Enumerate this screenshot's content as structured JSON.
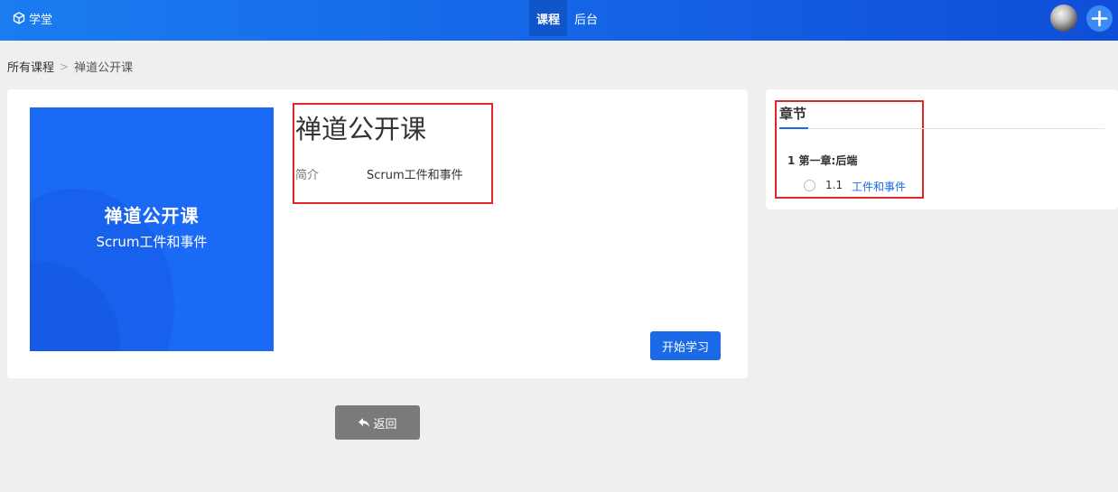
{
  "header": {
    "brand": "学堂",
    "tabs": [
      {
        "label": "课程",
        "active": true
      },
      {
        "label": "后台",
        "active": false
      }
    ],
    "accent_color": "#1668e8"
  },
  "breadcrumb": {
    "root": "所有课程",
    "separator": ">",
    "current": "禅道公开课"
  },
  "course": {
    "cover_title": "禅道公开课",
    "cover_subtitle": "Scrum工件和事件",
    "title": "禅道公开课",
    "intro_label": "简介",
    "intro_value": "Scrum工件和事件",
    "start_button": "开始学习"
  },
  "chapters": {
    "heading": "章节",
    "chapter": "1  第一章:后端",
    "lesson_number": "1.1",
    "lesson_title": "工件和事件"
  },
  "back_button": "返回",
  "colors": {
    "highlight_box": "#e0262b",
    "primary": "#1a6ae8",
    "page_bg": "#efefef"
  }
}
